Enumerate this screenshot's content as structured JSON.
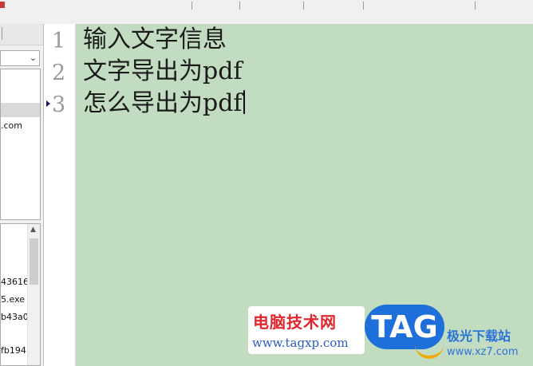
{
  "editor": {
    "lines": [
      {
        "number": "1",
        "text": "输入文字信息"
      },
      {
        "number": "2",
        "text": "文字导出为pdf"
      },
      {
        "number": "3",
        "text": "怎么导出为pdf"
      }
    ],
    "current_line": 3,
    "background_color": "#c2dcc2"
  },
  "left_panel": {
    "dropdown_value": "",
    "list_items": [
      ".com"
    ],
    "file_items": [
      "43616",
      "5.exe",
      "b43a0",
      "fb194"
    ]
  },
  "watermark": {
    "brand_cn": "电脑技术网",
    "brand_url": "www.tagxp.com",
    "tag": "TAG",
    "right_cn": "极光下载站",
    "right_url": "www.xz7.com",
    "colors": {
      "red": "#e0262c",
      "blue": "#1e6fd9",
      "orange": "#f2a900"
    }
  },
  "icons": [
    "chevron-down-icon",
    "scroll-up-icon",
    "bookmark-marker-icon"
  ]
}
